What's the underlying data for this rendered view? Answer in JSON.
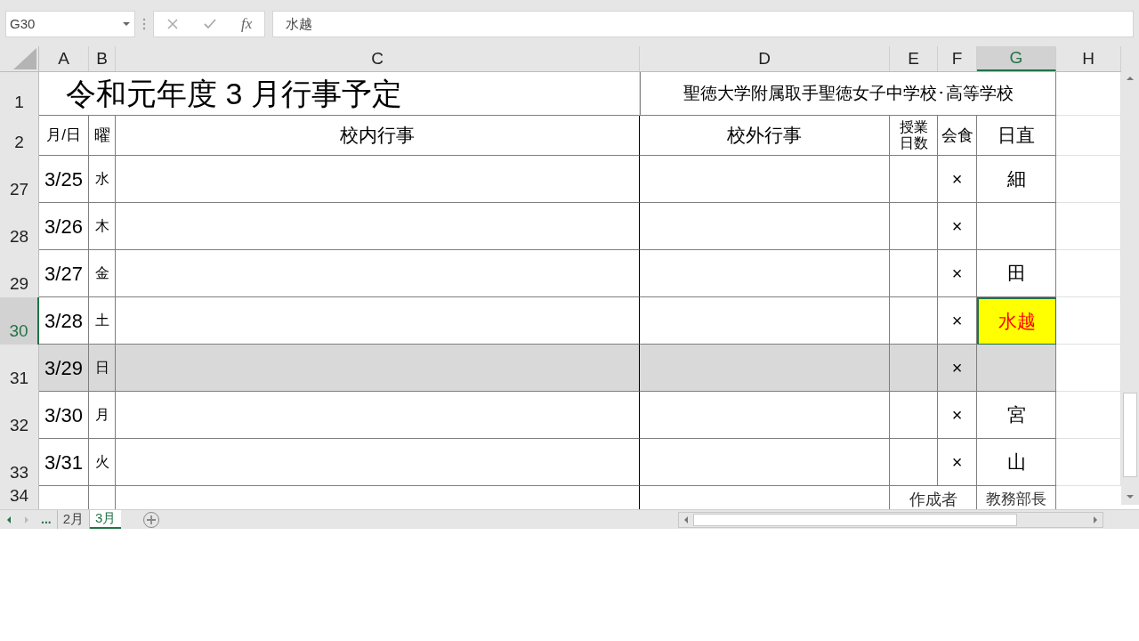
{
  "name_box": "G30",
  "formula_bar": {
    "function_label": "fx",
    "value": "水越"
  },
  "columns": [
    {
      "label": "A",
      "selected": false
    },
    {
      "label": "B",
      "selected": false
    },
    {
      "label": "C",
      "selected": false
    },
    {
      "label": "D",
      "selected": false
    },
    {
      "label": "E",
      "selected": false
    },
    {
      "label": "F",
      "selected": false
    },
    {
      "label": "G",
      "selected": true
    },
    {
      "label": "H",
      "selected": false
    }
  ],
  "title_row": {
    "row": "1",
    "title": "令和元年度 3 月行事予定",
    "school": "聖徳大学附属取手聖徳女子中学校･高等学校"
  },
  "header_row": {
    "row": "2",
    "headers": [
      "月/日",
      "曜",
      "校内行事",
      "校外行事",
      "授業日数",
      "会食",
      "日直"
    ]
  },
  "rows": [
    {
      "row": "27",
      "date": "3/25",
      "weekday": "水",
      "lunch": "×",
      "duty": "細",
      "shaded": false,
      "selected": false
    },
    {
      "row": "28",
      "date": "3/26",
      "weekday": "木",
      "lunch": "×",
      "shaded": false,
      "selected": false
    },
    {
      "row": "29",
      "date": "3/27",
      "weekday": "金",
      "lunch": "×",
      "duty": "田",
      "shaded": false,
      "selected": false
    },
    {
      "row": "30",
      "date": "3/28",
      "weekday": "土",
      "lunch": "×",
      "duty": "水越",
      "shaded": false,
      "selected": true
    },
    {
      "row": "31",
      "date": "3/29",
      "weekday": "日",
      "lunch": "×",
      "shaded": true,
      "selected": false
    },
    {
      "row": "32",
      "date": "3/30",
      "weekday": "月",
      "lunch": "×",
      "duty": "宮",
      "shaded": false,
      "selected": false
    },
    {
      "row": "33",
      "date": "3/31",
      "weekday": "火",
      "lunch": "×",
      "duty": "山",
      "shaded": false,
      "selected": false
    }
  ],
  "signature_row": {
    "row": "34",
    "labels": [
      "作成者",
      "教務部長"
    ]
  },
  "sheet_tabs": {
    "more": "...",
    "tabs": [
      {
        "label": "2月",
        "selected": false
      },
      {
        "label": "3月",
        "selected": true
      }
    ]
  }
}
